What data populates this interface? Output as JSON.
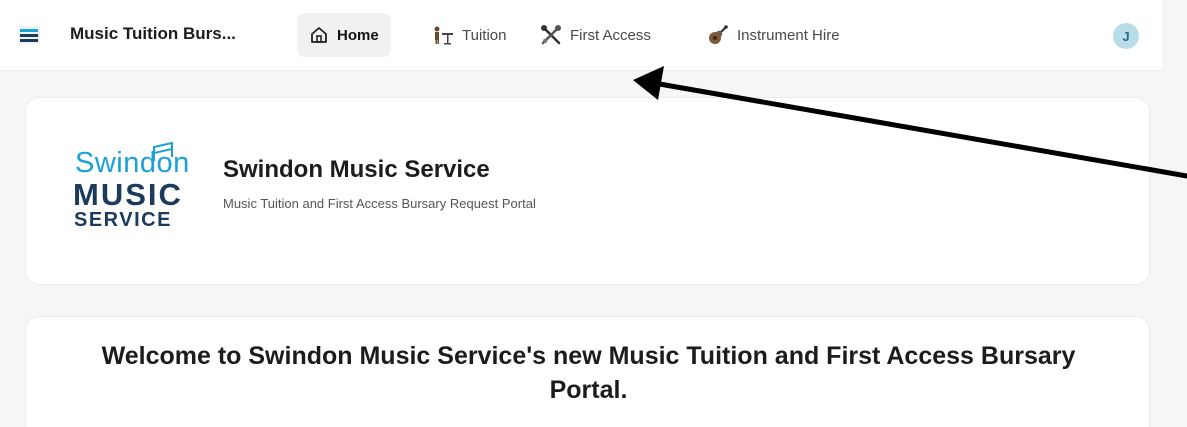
{
  "app": {
    "title": "Music Tuition Burs...",
    "logo_icon": "music-service-logo-icon"
  },
  "nav": {
    "items": [
      {
        "label": "Home",
        "icon": "home-icon",
        "active": true
      },
      {
        "label": "Tuition",
        "icon": "conductor-icon",
        "active": false
      },
      {
        "label": "First Access",
        "icon": "instruments-icon",
        "active": false
      },
      {
        "label": "Instrument Hire",
        "icon": "guitar-icon",
        "active": false
      }
    ]
  },
  "user": {
    "avatar_initial": "J",
    "avatar_color": "#b9dde8"
  },
  "header_card": {
    "logo": {
      "line1": "Swindon",
      "line2": "MUSIC",
      "line3": "SERVICE"
    },
    "org_name": "Swindon Music Service",
    "subtitle": "Music Tuition and First Access Bursary Request Portal"
  },
  "welcome_card": {
    "text": "Welcome to Swindon Music Service's new Music Tuition and First Access Bursary Portal."
  },
  "annotation": {
    "type": "arrow",
    "color": "#000000",
    "points_to": "First Access"
  }
}
